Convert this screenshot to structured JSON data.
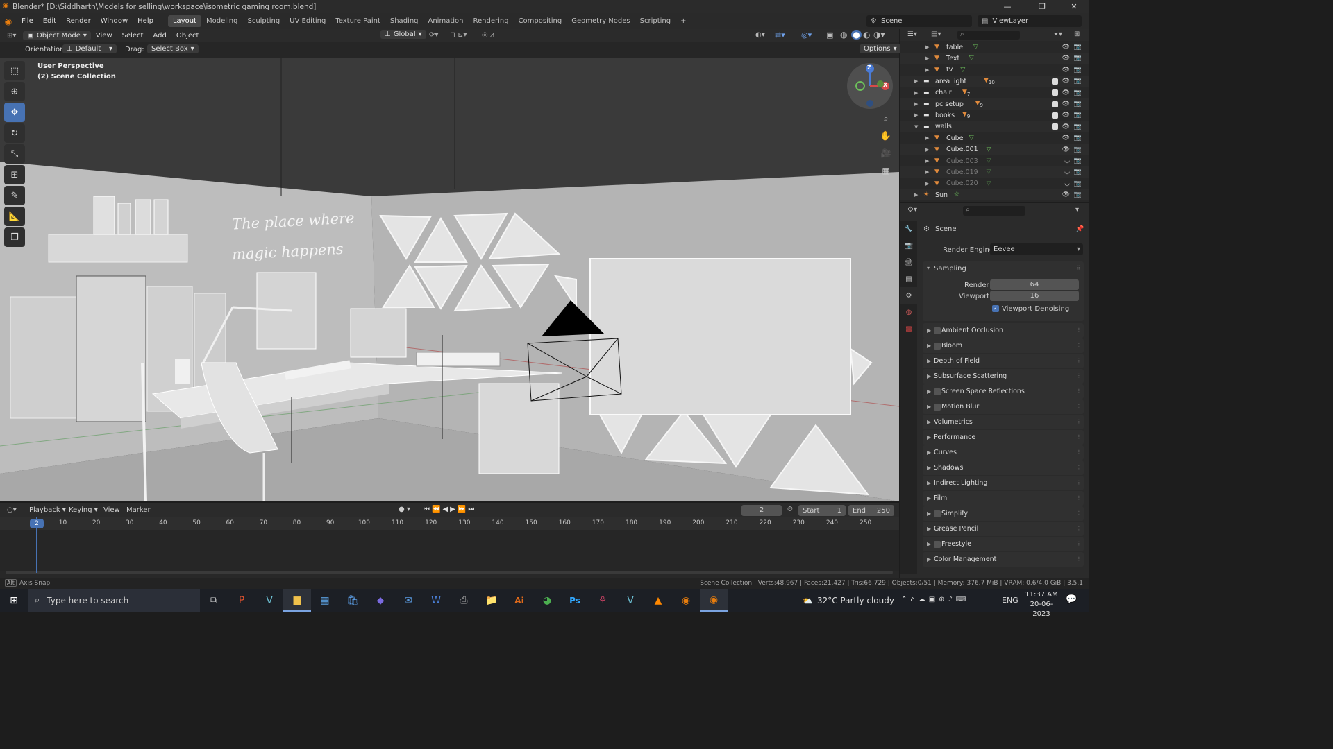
{
  "window": {
    "title": "Blender* [D:\\Siddharth\\Models for selling\\workspace\\isometric gaming room.blend]",
    "minimize": "—",
    "maximize": "❐",
    "close": "✕"
  },
  "menu": {
    "items": [
      "File",
      "Edit",
      "Render",
      "Window",
      "Help"
    ],
    "workspaces": [
      "Layout",
      "Modeling",
      "Sculpting",
      "UV Editing",
      "Texture Paint",
      "Shading",
      "Animation",
      "Rendering",
      "Compositing",
      "Geometry Nodes",
      "Scripting",
      "+"
    ],
    "active_workspace": "Layout",
    "scene": "Scene",
    "view_layer": "ViewLayer"
  },
  "viewport_header": {
    "mode": "Object Mode",
    "menus": [
      "View",
      "Select",
      "Add",
      "Object"
    ],
    "transform_orientation": "Global",
    "orientation_label": "Orientation:",
    "orientation_value": "Default",
    "drag_label": "Drag:",
    "drag_value": "Select Box",
    "options": "Options"
  },
  "viewport": {
    "perspective": "User Perspective",
    "collection": "(2) Scene Collection",
    "wall_text_line1": "The place where",
    "wall_text_line2": "magic happens",
    "gizmo": {
      "z": "Z",
      "y": "Y",
      "x": "X"
    }
  },
  "outliner": {
    "rows": [
      {
        "name": "table",
        "indent": 2,
        "type": "mesh",
        "expanded": false,
        "dimmed": false,
        "check": false
      },
      {
        "name": "Text",
        "indent": 2,
        "type": "mesh",
        "expanded": false,
        "dimmed": false,
        "check": false
      },
      {
        "name": "tv",
        "indent": 2,
        "type": "mesh",
        "expanded": false,
        "dimmed": false,
        "check": false
      },
      {
        "name": "area light",
        "indent": 1,
        "type": "collection",
        "badge": "10",
        "expanded": false,
        "dimmed": false,
        "check": true
      },
      {
        "name": "chair",
        "indent": 1,
        "type": "collection",
        "badge": "7",
        "expanded": false,
        "dimmed": false,
        "check": true
      },
      {
        "name": "pc setup",
        "indent": 1,
        "type": "collection",
        "badge": "9",
        "expanded": false,
        "dimmed": false,
        "check": true
      },
      {
        "name": "books",
        "indent": 1,
        "type": "collection",
        "badge": "9",
        "expanded": false,
        "dimmed": false,
        "check": true
      },
      {
        "name": "walls",
        "indent": 1,
        "type": "collection",
        "expanded": true,
        "dimmed": false,
        "check": true
      },
      {
        "name": "Cube",
        "indent": 2,
        "type": "mesh",
        "expanded": false,
        "dimmed": false,
        "check": false
      },
      {
        "name": "Cube.001",
        "indent": 2,
        "type": "mesh",
        "expanded": false,
        "dimmed": false,
        "check": false
      },
      {
        "name": "Cube.003",
        "indent": 2,
        "type": "mesh",
        "expanded": false,
        "dimmed": true,
        "check": false
      },
      {
        "name": "Cube.019",
        "indent": 2,
        "type": "mesh",
        "expanded": false,
        "dimmed": true,
        "check": false
      },
      {
        "name": "Cube.020",
        "indent": 2,
        "type": "mesh",
        "expanded": false,
        "dimmed": true,
        "check": false
      },
      {
        "name": "Sun",
        "indent": 1,
        "type": "light",
        "expanded": false,
        "dimmed": false,
        "check": false
      }
    ]
  },
  "properties": {
    "context": "Scene",
    "render_engine_label": "Render Engine",
    "render_engine": "Eevee",
    "sampling_label": "Sampling",
    "render_label": "Render",
    "render_samples": "64",
    "viewport_label": "Viewport",
    "viewport_samples": "16",
    "denoising_label": "Viewport Denoising",
    "panels": [
      {
        "label": "Ambient Occlusion",
        "checkbox": true
      },
      {
        "label": "Bloom",
        "checkbox": true
      },
      {
        "label": "Depth of Field",
        "checkbox": false
      },
      {
        "label": "Subsurface Scattering",
        "checkbox": false
      },
      {
        "label": "Screen Space Reflections",
        "checkbox": true
      },
      {
        "label": "Motion Blur",
        "checkbox": true
      },
      {
        "label": "Volumetrics",
        "checkbox": false
      },
      {
        "label": "Performance",
        "checkbox": false
      },
      {
        "label": "Curves",
        "checkbox": false
      },
      {
        "label": "Shadows",
        "checkbox": false
      },
      {
        "label": "Indirect Lighting",
        "checkbox": false
      },
      {
        "label": "Film",
        "checkbox": false
      },
      {
        "label": "Simplify",
        "checkbox": true
      },
      {
        "label": "Grease Pencil",
        "checkbox": false
      },
      {
        "label": "Freestyle",
        "checkbox": true
      },
      {
        "label": "Color Management",
        "checkbox": false
      }
    ]
  },
  "timeline": {
    "menus": [
      "Playback",
      "Keying",
      "View",
      "Marker"
    ],
    "current_frame": "2",
    "start_label": "Start",
    "start": "1",
    "end_label": "End",
    "end": "250",
    "ticks": [
      "10",
      "20",
      "30",
      "40",
      "50",
      "60",
      "70",
      "80",
      "90",
      "100",
      "110",
      "120",
      "130",
      "140",
      "150",
      "160",
      "170",
      "180",
      "190",
      "200",
      "210",
      "220",
      "230",
      "240",
      "250"
    ]
  },
  "status": {
    "left_key": "Alt",
    "left_text": "Axis Snap",
    "right_text": "Scene Collection | Verts:48,967 | Faces:21,427 | Tris:66,729 | Objects:0/51 | Memory: 376.7 MiB | VRAM: 0.6/4.0 GiB | 3.5.1"
  },
  "taskbar": {
    "search_placeholder": "Type here to search",
    "weather": "32°C  Partly cloudy",
    "language": "ENG",
    "time": "11:37 AM",
    "date": "20-06-2023"
  },
  "colors": {
    "accent": "#4772b3",
    "mesh_icon": "#e08a3c",
    "data_icon": "#6cbf5a",
    "active_frame": "#4772b3"
  }
}
